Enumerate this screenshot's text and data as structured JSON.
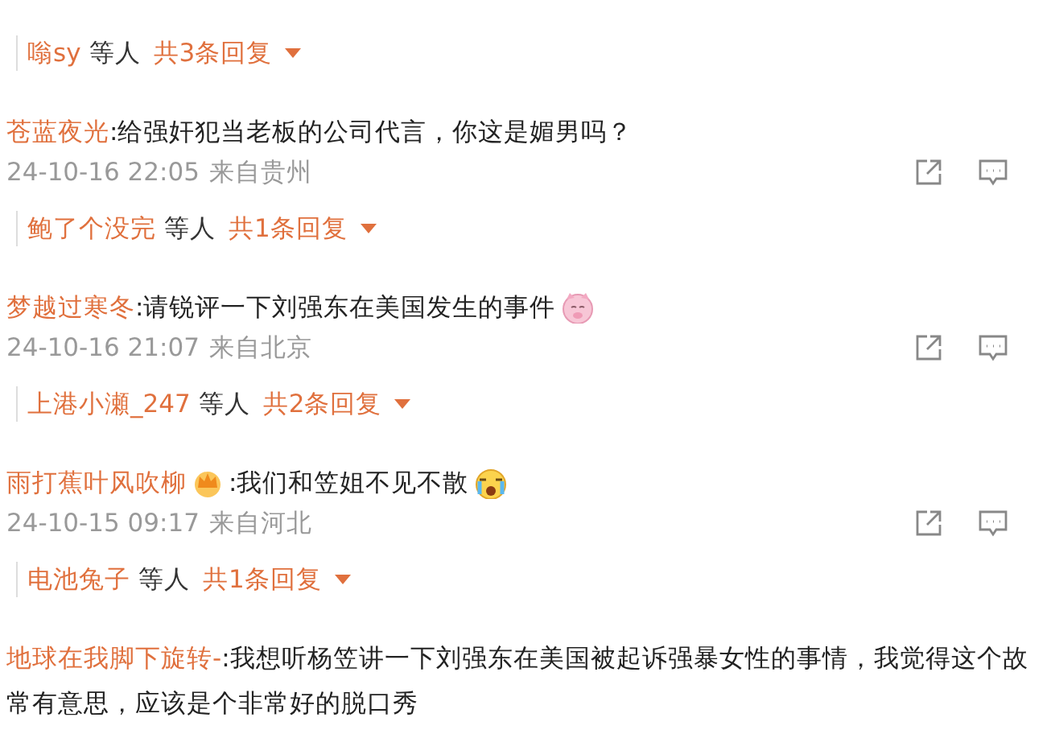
{
  "top_replies": {
    "names": "嗡sy",
    "suffix": "等人",
    "count": "共3条回复"
  },
  "comments": [
    {
      "author": "苍蓝夜光",
      "badge": false,
      "text_lines": [
        ":给强奸犯当老板的公司代言，你这是媚男吗？"
      ],
      "kind": "plain",
      "time": "24-10-16 22:05",
      "location": "来自贵州",
      "replies": {
        "names": "鲍了个没完",
        "suffix": "等人",
        "count": "共1条回复"
      }
    },
    {
      "author": "梦越过寒冬",
      "badge": false,
      "text_lines": [
        ":请锐评一下刘强东在美国发生的事件"
      ],
      "kind": "pig",
      "time": "24-10-16 21:07",
      "location": "来自北京",
      "replies": {
        "names": "上港小瀬_247",
        "suffix": "等人",
        "count": "共2条回复"
      }
    },
    {
      "author": "雨打蕉叶风吹柳",
      "badge": true,
      "text_lines": [
        ":我们和笠姐不见不散"
      ],
      "kind": "crying",
      "time": "24-10-15 09:17",
      "location": "来自河北",
      "replies": {
        "names": "电池兔子",
        "suffix": "等人",
        "count": "共1条回复"
      }
    },
    {
      "author": "地球在我脚下旋转-",
      "badge": false,
      "text_lines": [
        ":我想听杨笠讲一下刘强东在美国被起诉强暴女性的事情，我觉得这个故",
        "常有意思，应该是个非常好的脱口秀"
      ],
      "kind": "plain"
    }
  ]
}
